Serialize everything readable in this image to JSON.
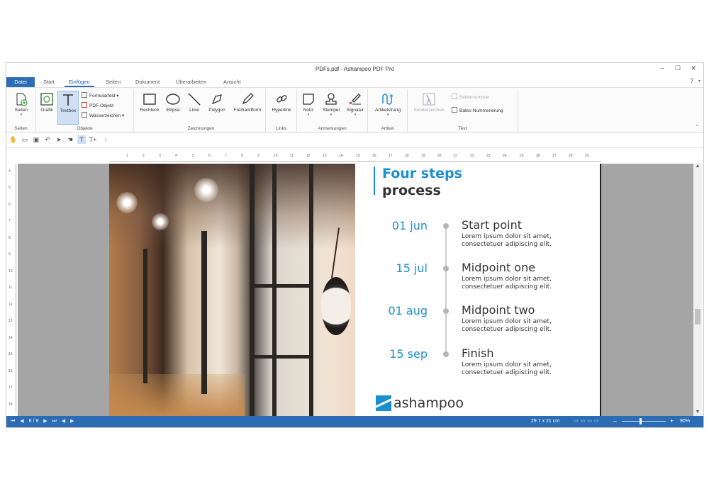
{
  "window": {
    "title": "PDFs.pdf - Ashampoo PDF Pro",
    "minimize": "–",
    "maximize": "☐",
    "close": "✕"
  },
  "tabs": [
    "Datei",
    "Start",
    "Einfügen",
    "Seiten",
    "Dokument",
    "Überarbeiten",
    "Ansicht"
  ],
  "active_tab": "Einfügen",
  "help": "?",
  "ribbon": {
    "groups": {
      "seiten": {
        "label": "Seiten",
        "button": "Seiten"
      },
      "objekte": {
        "label": "Objekte",
        "grafik": "Grafik",
        "textbox": "Textbox",
        "formularfeld": "Formularfeld",
        "pdf_objekt": "PDF-Objekt",
        "wasserzeichen": "Wasserzeichen"
      },
      "zeichnungen": {
        "label": "Zeichnungen",
        "items": [
          "Rechteck",
          "Ellipse",
          "Linie",
          "Polygon",
          "Freihandform"
        ]
      },
      "links": {
        "label": "Links",
        "hyperlink": "Hyperlink"
      },
      "anmerkungen": {
        "label": "Anmerkungen",
        "items": [
          "Notiz",
          "Stempel",
          "Signatur"
        ]
      },
      "artikel": {
        "label": "Artikel",
        "artikelstrang": "Artikelstrang"
      },
      "text": {
        "label": "Text",
        "sonderzeichen": "Sonderzeichen",
        "seitennummer": "Seitennummer",
        "bates": "Bates-Nummerierung"
      }
    }
  },
  "hruler_labels": [
    "1",
    "2",
    "3",
    "4",
    "5",
    "6",
    "7",
    "8",
    "9",
    "10",
    "11",
    "12",
    "13",
    "14",
    "15",
    "16",
    "17",
    "18",
    "19",
    "20",
    "21",
    "22",
    "23",
    "24",
    "25",
    "26",
    "27",
    "28",
    "29"
  ],
  "vruler_labels": [
    "4",
    "5",
    "6",
    "7",
    "8",
    "9",
    "10",
    "11",
    "12",
    "13",
    "14",
    "15",
    "16",
    "17",
    "18"
  ],
  "document": {
    "heading_line1": "Four steps",
    "heading_line2": "process",
    "steps": [
      {
        "date": "01 jun",
        "title": "Start point",
        "desc": "Lorem ipsum dolor sit amet, consectetuer adipiscing elit."
      },
      {
        "date": "15 jul",
        "title": "Midpoint one",
        "desc": "Lorem ipsum dolor sit amet, consectetuer adipiscing elit."
      },
      {
        "date": "01 aug",
        "title": "Midpoint two",
        "desc": "Lorem ipsum dolor sit amet, consectetuer adipiscing elit."
      },
      {
        "date": "15 sep",
        "title": "Finish",
        "desc": "Lorem ipsum dolor sit amet, consectetuer adipiscing elit."
      }
    ],
    "logo_text": "ashampoo"
  },
  "status": {
    "page": "6 / 9",
    "dimensions": "29.7 x 21 cm",
    "zoom": "90%",
    "zoom_minus": "–",
    "zoom_plus": "+"
  },
  "colors": {
    "accent": "#1b8fd0",
    "statusbar": "#2b6cb5",
    "text": "#333333"
  }
}
